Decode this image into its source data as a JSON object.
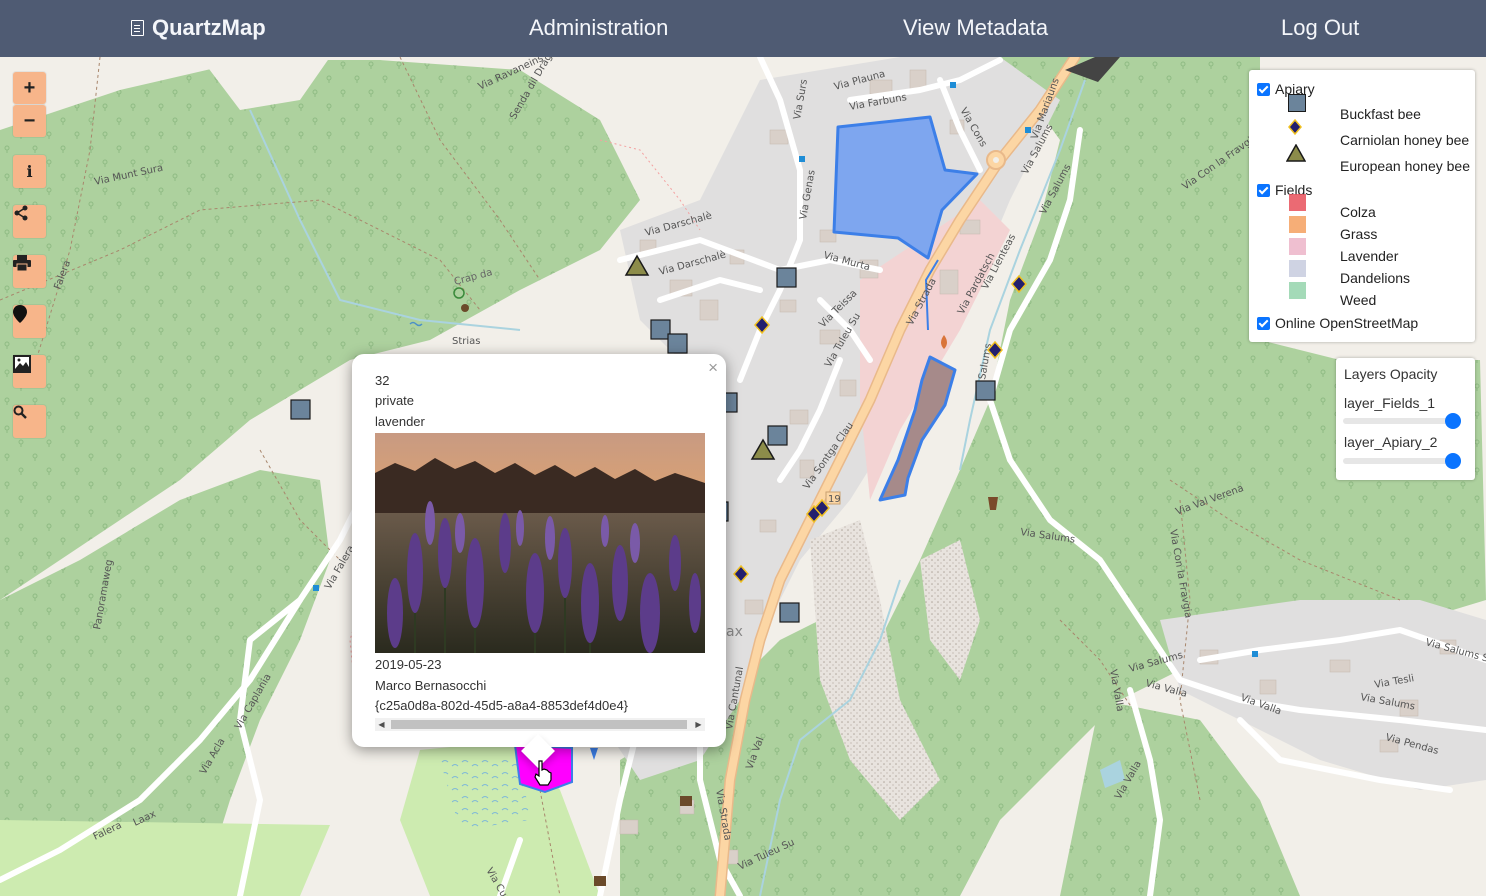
{
  "nav": {
    "brand": "QuartzMap",
    "items": [
      {
        "label": "Administration"
      },
      {
        "label": "View Metadata"
      },
      {
        "label": "Log Out"
      }
    ]
  },
  "tools": {
    "zoom_in": "+",
    "zoom_out": "−",
    "icons": [
      "info-icon",
      "share-icon",
      "print-icon",
      "location-pin-icon",
      "image-icon",
      "search-icon"
    ]
  },
  "legend": {
    "groups": [
      {
        "label": "Apiary",
        "checked": true,
        "items": [
          {
            "label": "Buckfast bee",
            "symbol": "square",
            "color": "#6b849b"
          },
          {
            "label": "Carniolan honey bee",
            "symbol": "diamond",
            "color": "#231f6e"
          },
          {
            "label": "European honey bee",
            "symbol": "triangle",
            "color": "#8c8c4a"
          }
        ]
      },
      {
        "label": "Fields",
        "checked": true,
        "items": [
          {
            "label": "Colza",
            "color": "#e8505b"
          },
          {
            "label": "Grass",
            "color": "#f5a05f"
          },
          {
            "label": "Lavender",
            "color": "#efbfd0"
          },
          {
            "label": "Dandelions",
            "color": "#cfd3e3"
          },
          {
            "label": "Weed",
            "color": "#a4dab8"
          }
        ]
      },
      {
        "label": "Online OpenStreetMap",
        "checked": true,
        "items": []
      }
    ]
  },
  "opacity_panel": {
    "title": "Layers Opacity",
    "layers": [
      {
        "name": "layer_Fields_1",
        "value": 1.0
      },
      {
        "name": "layer_Apiary_2",
        "value": 1.0
      }
    ]
  },
  "popup": {
    "close": "×",
    "lines_top": [
      "32",
      "private",
      "lavender"
    ],
    "date": "2019-05-23",
    "author": "Marco Bernasocchi",
    "uuid": "{c25a0d8a-802d-45d5-a8a4-8853def4d0e4}"
  },
  "map_labels": [
    "Via Munt Sura",
    "Via Ravaneins",
    "Senda dil Dragun",
    "Via Surs",
    "Via Plauna",
    "Via Farbuns",
    "Via Genas",
    "Via Darschalè",
    "Via Murta",
    "Via Teissa",
    "Via Tuleu Su",
    "Via Strada",
    "Via Pardatsch",
    "Via Lienteas",
    "Via Salums",
    "Via Con la Fravgia",
    "Via Val Verena",
    "Via Salums Su",
    "Via Tesli",
    "Via Valla",
    "Via Pendas",
    "Via Cantunal",
    "Via Val",
    "Via Caplania",
    "Via Acla",
    "Via Falera",
    "Panoramaweg",
    "Laax",
    "Falera",
    "Crap da Strias",
    "Via Sontga Clau",
    "Via Tuleu Su",
    "Via Curtin",
    "19",
    "Via Mariauns",
    "Via Cons"
  ],
  "map_colors": {
    "forest": "#add19e",
    "land": "#f2efe9",
    "road": "#ffffff",
    "primary_road": "#fcd6a4",
    "residential": "#e0dfdf",
    "building": "#d9d0c9",
    "field_blue": "#7ea6ef",
    "field_brown": "#a68a8a",
    "field_magenta": "#ff00ff",
    "meadow": "#cdebb0"
  }
}
